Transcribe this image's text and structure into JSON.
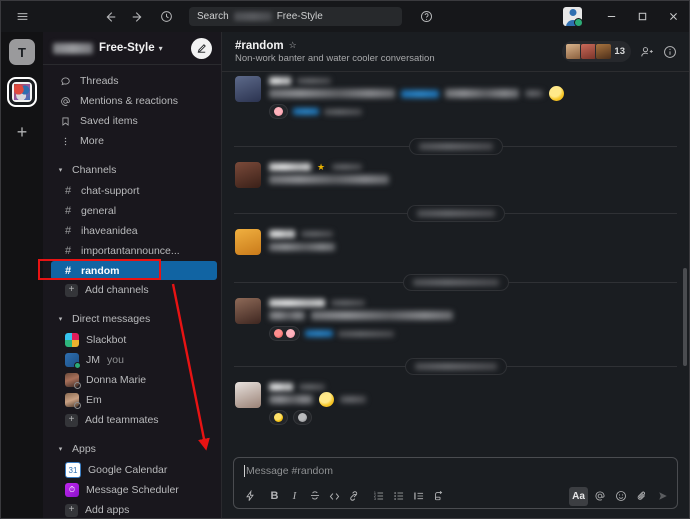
{
  "titlebar": {
    "menu_icon": "hamburger-icon",
    "back_icon": "arrow-left-icon",
    "forward_icon": "arrow-right-icon",
    "history_icon": "clock-icon",
    "search_label": "Search",
    "search_scope": "Free-Style",
    "help_icon": "help-circle-icon",
    "minimize_label": "–",
    "maximize_label": "□",
    "close_label": "✕"
  },
  "rail": {
    "workspace_badge": "T",
    "active_workspace": "free-style-workspace",
    "add_label": "+"
  },
  "sidebar": {
    "workspace_name": "Free-Style",
    "caret": "▾",
    "compose_icon": "compose-icon",
    "nav": [
      {
        "label": "Threads",
        "icon": "threads-icon"
      },
      {
        "label": "Mentions & reactions",
        "icon": "at-icon"
      },
      {
        "label": "Saved items",
        "icon": "bookmark-icon"
      },
      {
        "label": "More",
        "icon": "more-vertical-icon"
      }
    ],
    "channels_section": "Channels",
    "channels": [
      {
        "label": "chat-support",
        "active": false
      },
      {
        "label": "general",
        "active": false
      },
      {
        "label": "ihaveanidea",
        "active": false
      },
      {
        "label": "importantannounce...",
        "active": false
      },
      {
        "label": "random",
        "active": true
      }
    ],
    "add_channels": "Add channels",
    "dm_section": "Direct messages",
    "dms": [
      {
        "label": "Slackbot",
        "presence": "none"
      },
      {
        "label": "JM",
        "suffix": "you",
        "presence": "online"
      },
      {
        "label": "Donna Marie",
        "presence": "away"
      },
      {
        "label": "Em",
        "presence": "away"
      }
    ],
    "add_teammates": "Add teammates",
    "apps_section": "Apps",
    "apps": [
      {
        "label": "Google Calendar"
      },
      {
        "label": "Message Scheduler"
      }
    ],
    "add_apps": "Add apps"
  },
  "channel_header": {
    "title": "#random",
    "star_icon": "star-icon",
    "description": "Non-work banter and water cooler conversation",
    "member_count": "13",
    "add_member_icon": "add-person-icon",
    "info_icon": "info-circle-icon"
  },
  "composer": {
    "placeholder": "Message #random",
    "tools": [
      {
        "name": "shortcuts-icon",
        "glyph": "⚡"
      },
      {
        "name": "bold-icon",
        "glyph": "B"
      },
      {
        "name": "italic-icon",
        "glyph": "I"
      },
      {
        "name": "strikethrough-icon",
        "glyph": "S"
      },
      {
        "name": "code-icon",
        "glyph": "<>"
      },
      {
        "name": "link-icon",
        "glyph": "🔗"
      },
      {
        "name": "ordered-list-icon",
        "glyph": "1."
      },
      {
        "name": "bulleted-list-icon",
        "glyph": "•"
      },
      {
        "name": "blockquote-icon",
        "glyph": "❝"
      },
      {
        "name": "code-block-icon",
        "glyph": "⌨"
      }
    ],
    "right_tools": [
      {
        "name": "formatting-toggle",
        "glyph": "Aa",
        "active": true
      },
      {
        "name": "mention-icon",
        "glyph": "@",
        "active": false
      },
      {
        "name": "emoji-icon",
        "glyph": "☺",
        "active": false
      },
      {
        "name": "attachment-icon",
        "glyph": "📎",
        "active": false
      },
      {
        "name": "send-icon",
        "glyph": "➤",
        "active": false
      }
    ]
  },
  "messages": {
    "note": "message content is blurred/redacted in the screenshot",
    "items": [
      {
        "type": "message",
        "redacted": true,
        "has_reactions": true
      },
      {
        "type": "date-divider",
        "redacted": true
      },
      {
        "type": "message",
        "redacted": true,
        "has_reactions": false
      },
      {
        "type": "date-divider",
        "redacted": true
      },
      {
        "type": "message",
        "redacted": true,
        "has_reactions": false
      },
      {
        "type": "date-divider",
        "redacted": true
      },
      {
        "type": "message",
        "redacted": true,
        "has_reactions": true
      },
      {
        "type": "date-divider",
        "redacted": true
      },
      {
        "type": "message",
        "redacted": true,
        "has_reactions": true
      }
    ]
  },
  "annotation": {
    "highlight_target": "random",
    "arrow_from": "sidebar-channel-random",
    "arrow_to": "message-composer",
    "color": "#e81313"
  }
}
